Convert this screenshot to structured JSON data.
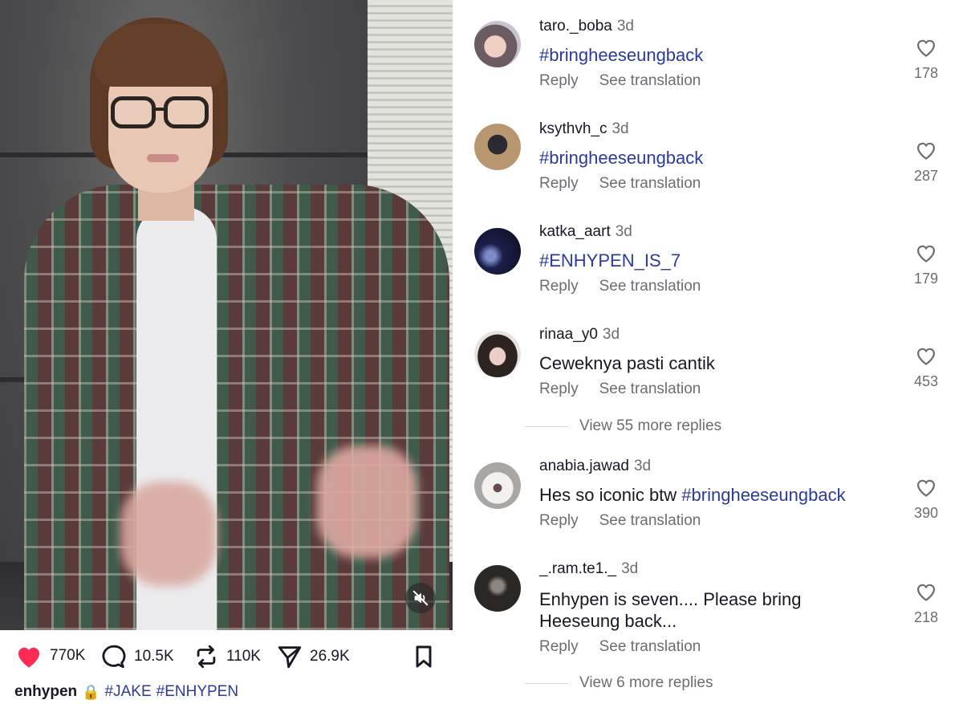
{
  "post": {
    "stats": {
      "likes": "770K",
      "comments": "10.5K",
      "reposts": "110K",
      "shares": "26.9K"
    },
    "caption": {
      "username": "enhypen",
      "lock_emoji": "🔒",
      "hashtags": [
        "#JAKE",
        "#ENHYPEN"
      ]
    },
    "colors": {
      "like_red": "#fe2c55",
      "hashtag_blue": "#2b3a9e"
    }
  },
  "comments": [
    {
      "username": "taro._boba",
      "time": "3d",
      "text": "#bringheeseungback",
      "is_hashtag": true,
      "likes": "178",
      "reply": "Reply",
      "translate": "See translation"
    },
    {
      "username": "ksythvh_c",
      "time": "3d",
      "text": "#bringheeseungback",
      "is_hashtag": true,
      "likes": "287",
      "reply": "Reply",
      "translate": "See translation"
    },
    {
      "username": "katka_aart",
      "time": "3d",
      "text": "#ENHYPEN_IS_7",
      "is_hashtag": true,
      "likes": "179",
      "reply": "Reply",
      "translate": "See translation"
    },
    {
      "username": "rinaa_y0",
      "time": "3d",
      "text": "Ceweknya pasti cantik",
      "is_hashtag": false,
      "likes": "453",
      "reply": "Reply",
      "translate": "See translation",
      "view_more": "View 55 more replies"
    },
    {
      "username": "anabia.jawad",
      "time": "3d",
      "text_plain": "Hes so iconic btw ",
      "text_hashtag": "#bringheeseungback",
      "likes": "390",
      "reply": "Reply",
      "translate": "See translation"
    },
    {
      "username": "_.ram.te1._",
      "time": "3d",
      "text_line1": "Enhypen is seven.... Please bring",
      "text_line2": "Heeseung back...",
      "likes": "218",
      "reply": "Reply",
      "translate": "See translation",
      "view_more": "View 6 more replies"
    }
  ]
}
